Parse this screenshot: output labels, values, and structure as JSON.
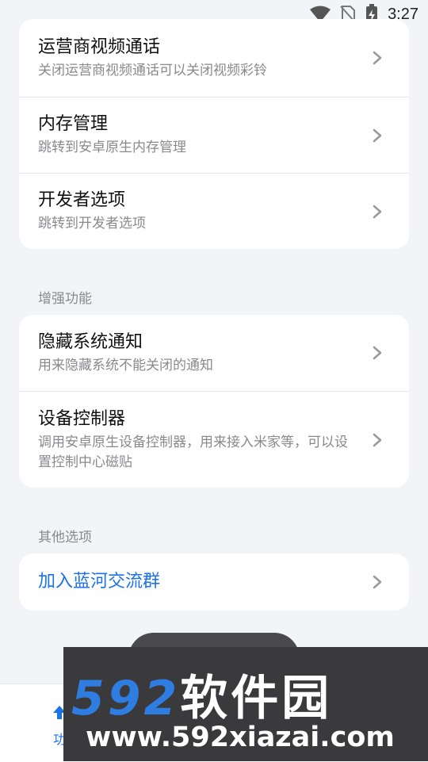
{
  "status_bar": {
    "time": "3:27"
  },
  "top_group": {
    "items": [
      {
        "title": "运营商视频通话",
        "desc": "关闭运营商视频通话可以关闭视频彩铃"
      },
      {
        "title": "内存管理",
        "desc": "跳转到安卓原生内存管理"
      },
      {
        "title": "开发者选项",
        "desc": "跳转到开发者选项"
      }
    ]
  },
  "enhance": {
    "label": "增强功能",
    "items": [
      {
        "title": "隐藏系统通知",
        "desc": "用来隐藏系统不能关闭的通知"
      },
      {
        "title": "设备控制器",
        "desc": "调用安卓原生设备控制器，用来接入米家等，可以设置控制中心磁贴"
      }
    ]
  },
  "other": {
    "label": "其他选项",
    "items": [
      {
        "title": "加入蓝河交流群"
      }
    ]
  },
  "bottom_nav": {
    "label": "功"
  },
  "watermark": {
    "brand_num": "592",
    "brand_cn": "软件园",
    "url": "www.592xiazai.com"
  },
  "colors": {
    "accent": "#1a73e8",
    "background": "#f3f4f8",
    "card": "#ffffff",
    "secondary_text": "#8a8a8e"
  }
}
